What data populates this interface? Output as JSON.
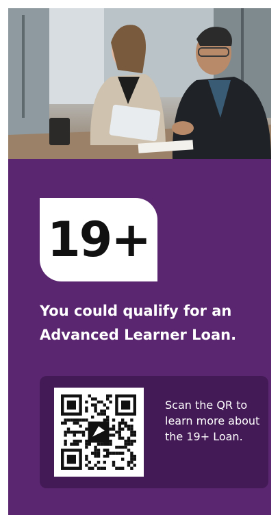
{
  "hero": {
    "image_icon": "business-meeting-photo"
  },
  "badge": {
    "text": "19+"
  },
  "headline": "You could qualify for an Advanced Learner Loan.",
  "qr": {
    "icon": "qr-code-icon",
    "description": "Scan the QR to learn more about the 19+ Loan."
  },
  "colors": {
    "card_bg": "#5a2670",
    "qr_panel_bg": "#441a56",
    "badge_bg": "#ffffff",
    "text": "#ffffff"
  }
}
